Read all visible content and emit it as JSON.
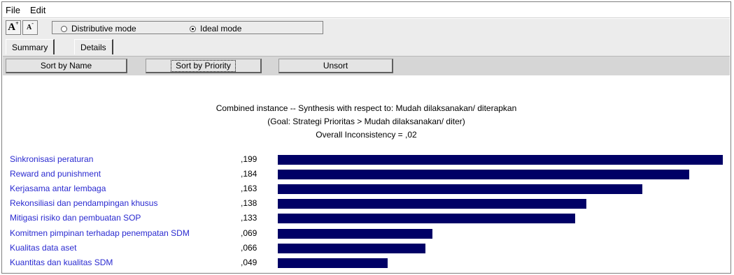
{
  "menu": {
    "file": "File",
    "edit": "Edit"
  },
  "toolbar": {
    "font_larger_icon": "font-larger-icon",
    "font_smaller_icon": "font-smaller-icon",
    "mode_distributive": "Distributive mode",
    "mode_ideal": "Ideal mode",
    "selected_mode": "Ideal mode"
  },
  "tabs": [
    {
      "label": "Summary",
      "active": true
    },
    {
      "label": "Details",
      "active": false
    }
  ],
  "sort_buttons": {
    "by_name": "Sort by Name",
    "by_priority": "Sort by Priority",
    "unsort": "Unsort"
  },
  "synthesis": {
    "line1": "Combined instance -- Synthesis with respect to: Mudah dilaksanakan/ diterapkan",
    "line2": "(Goal: Strategi Prioritas  > Mudah dilaksanakan/ diter)",
    "line3": "Overall Inconsistency = ,02"
  },
  "colors": {
    "bar": "#000066",
    "label": "#2a2ad0"
  },
  "chart_data": {
    "type": "bar",
    "orientation": "horizontal",
    "categories": [
      "Sinkronisasi peraturan",
      "Reward and punishment",
      "Kerjasama antar lembaga",
      "Rekonsiliasi dan pendampingan khusus",
      "Mitigasi risiko dan pembuatan SOP",
      "Komitmen pimpinan terhadap penempatan SDM",
      "Kualitas data aset",
      "Kuantitas dan kualitas SDM"
    ],
    "value_labels": [
      ",199",
      ",184",
      ",163",
      ",138",
      ",133",
      ",069",
      ",066",
      ",049"
    ],
    "values": [
      0.199,
      0.184,
      0.163,
      0.138,
      0.133,
      0.069,
      0.066,
      0.049
    ]
  }
}
